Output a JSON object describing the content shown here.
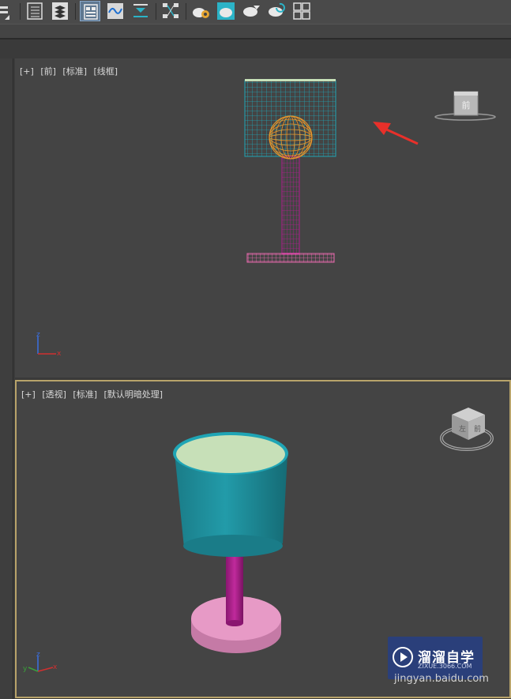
{
  "toolbar": {
    "buttons": [
      {
        "icon": "layer-list-icon"
      },
      {
        "icon": "scene-explorer-icon"
      },
      {
        "icon": "layer-stack-icon"
      },
      {
        "icon": "ribbon-toggle-icon",
        "active": true
      },
      {
        "icon": "curve-editor-icon"
      },
      {
        "icon": "dope-sheet-icon"
      },
      {
        "icon": "schematic-view-icon"
      },
      {
        "icon": "render-setup-icon"
      },
      {
        "icon": "rendered-frame-window-icon"
      },
      {
        "icon": "render-production-icon"
      },
      {
        "icon": "render-iterative-icon"
      },
      {
        "icon": "material-editor-icon"
      }
    ]
  },
  "viewports": {
    "front": {
      "label_plus": "[+]",
      "label_view": "[前]",
      "label_shading": "[标准]",
      "label_style": "[线框]",
      "viewcube_text": "前"
    },
    "perspective": {
      "label_plus": "[+]",
      "label_view": "[透视]",
      "label_shading": "[标准]",
      "label_style": "[默认明暗处理]",
      "viewcube_left_text": "左",
      "viewcube_right_text": "前"
    }
  },
  "axes": {
    "x": "x",
    "y": "y",
    "z": "z"
  },
  "watermark": {
    "title": "溜溜自学",
    "subtitle": "ZIXUE.3066.COM",
    "url": "jingyan.baidu.com"
  },
  "colors": {
    "viewport_bg": "#444444",
    "lampshade_wire": "#1fa5b5",
    "sphere_wire": "#e8962b",
    "stand_wire": "#b01d8e",
    "base_wire": "#ec6ab0",
    "lampshade_solid": "#1e8f9c",
    "lampshade_top": "#c7e0b8",
    "stand_solid": "#b01d8e",
    "base_solid": "#e79ac6",
    "active_border": "#b8a36a",
    "arrow": "#e8302a"
  }
}
